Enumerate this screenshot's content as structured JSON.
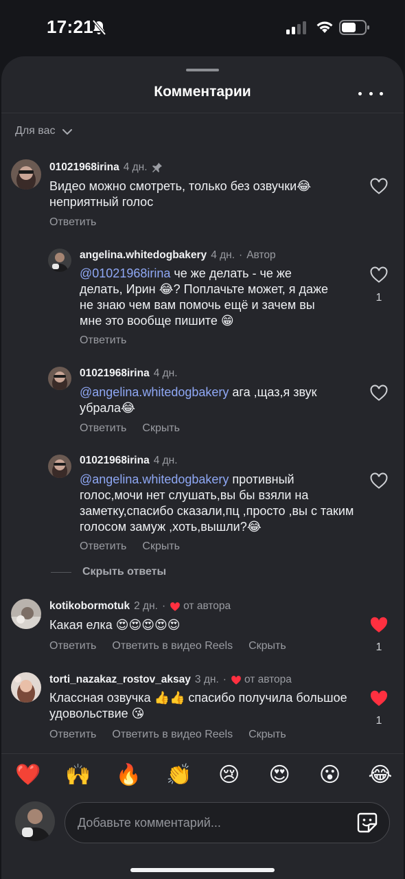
{
  "status": {
    "time": "17:21"
  },
  "header": {
    "title": "Комментарии"
  },
  "filter": {
    "label": "Для вас"
  },
  "comments": [
    {
      "username": "01021968irina",
      "time": "4 дн.",
      "pinned": true,
      "text": "Видео можно смотреть, только без озвучки😂 неприятный голос",
      "reply_label": "Ответить"
    },
    {
      "username": "angelina.whitedogbakery",
      "time": "4 дн.",
      "author_label": "Автор",
      "mention": "@01021968irina",
      "text": " че же делать - че же делать, Ирин 😂? Поплачьте может, я даже не знаю чем вам помочь ещё и зачем вы мне это вообще пишите 😁",
      "reply_label": "Ответить",
      "like_count": "1"
    },
    {
      "username": "01021968irina",
      "time": "4 дн.",
      "mention": "@angelina.whitedogbakery",
      "text": " ага ,щаз,я звук убрала😂",
      "reply_label": "Ответить",
      "hide_label": "Скрыть"
    },
    {
      "username": "01021968irina",
      "time": "4 дн.",
      "mention": "@angelina.whitedogbakery",
      "text": " противный голос,мочи нет слушать,вы бы взяли на заметку,спасибо сказали,пц ,просто ,вы с таким голосом замуж ,хоть,вышли?😂",
      "reply_label": "Ответить",
      "hide_label": "Скрыть"
    },
    {
      "username": "kotikobormotuk",
      "time": "2 дн.",
      "from_author": "от автора",
      "text": "Какая елка 😍😍😍😍😍",
      "reply_label": "Ответить",
      "reels_label": "Ответить в видео Reels",
      "hide_label": "Скрыть",
      "like_count": "1"
    },
    {
      "username": "torti_nazakaz_rostov_aksay",
      "time": "3 дн.",
      "from_author": "от автора",
      "text": "Классная озвучка 👍👍 спасибо получила большое удовольствие 😘",
      "reply_label": "Ответить",
      "reels_label": "Ответить в видео Reels",
      "hide_label": "Скрыть",
      "like_count": "1"
    }
  ],
  "hide_replies": "Скрыть ответы",
  "reactions": [
    "❤️",
    "🙌",
    "🔥",
    "👏",
    "😢",
    "😍",
    "😮",
    "😂"
  ],
  "composer": {
    "placeholder": "Добавьте комментарий..."
  },
  "colors": {
    "sheet": "#25262b",
    "mention": "#8fa8f5",
    "like_active": "#ff3040"
  }
}
